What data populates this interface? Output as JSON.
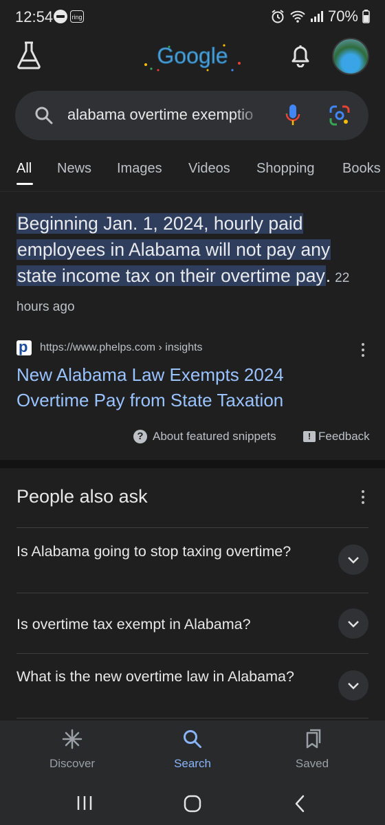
{
  "status_bar": {
    "time": "12:54",
    "ring_label": "ring",
    "battery": "70%"
  },
  "header": {
    "logo_text": "Google",
    "icons": [
      "labs-flask-icon",
      "notifications-bell-icon",
      "account-avatar"
    ]
  },
  "search": {
    "query": "alabama overtime exemptio"
  },
  "tabs": [
    {
      "label": "All",
      "active": true
    },
    {
      "label": "News"
    },
    {
      "label": "Images"
    },
    {
      "label": "Videos"
    },
    {
      "label": "Shopping"
    },
    {
      "label": "Books"
    }
  ],
  "featured_snippet": {
    "text": "Beginning Jan. 1, 2024, hourly paid employees in Alabama will not pay any state income tax on their overtime pay",
    "trailing": ".",
    "time_ago": "22 hours ago",
    "source_url": "https://www.phelps.com › insights",
    "result_title": "New Alabama Law Exempts 2024 Overtime Pay from State Taxation",
    "about_label": "About featured snippets",
    "feedback_label": "Feedback"
  },
  "people_also_ask": {
    "title": "People also ask",
    "questions": [
      "Is Alabama going to stop taxing overtime?",
      "Is overtime tax exempt in Alabama?",
      "What is the new overtime law in Alabama?"
    ]
  },
  "bottom_nav": [
    {
      "label": "Discover",
      "icon": "discover-asterisk-icon"
    },
    {
      "label": "Search",
      "icon": "search-icon",
      "active": true
    },
    {
      "label": "Saved",
      "icon": "saved-bookmark-icon"
    }
  ],
  "colors": {
    "background": "#1f1f1f",
    "link": "#99c3ff",
    "highlight": "#2f3e5c",
    "active_nav": "#8ab4f8"
  }
}
